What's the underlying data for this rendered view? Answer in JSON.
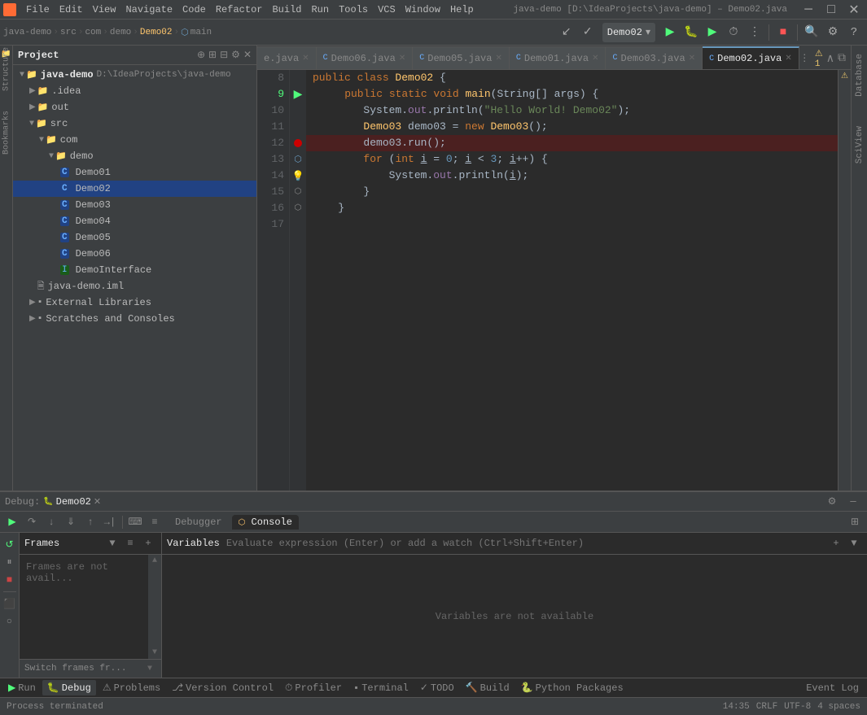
{
  "menubar": {
    "items": [
      "File",
      "Edit",
      "View",
      "Navigate",
      "Code",
      "Refactor",
      "Build",
      "Run",
      "Tools",
      "VCS",
      "Window",
      "Help"
    ]
  },
  "titlebar": {
    "project": "java-demo",
    "path": "D:\\IdeaProjects\\java-demo",
    "separator": "–",
    "file": "Demo02.java"
  },
  "breadcrumb": {
    "items": [
      "java-demo",
      "src",
      "com",
      "demo",
      "Demo02",
      "main"
    ]
  },
  "toolbar": {
    "run_config": "Demo02",
    "buttons": [
      "run",
      "debug",
      "run-coverage",
      "profile",
      "stop"
    ]
  },
  "tabs": [
    {
      "label": "e.java",
      "active": false,
      "modified": false
    },
    {
      "label": "Demo06.java",
      "active": false,
      "modified": false
    },
    {
      "label": "Demo05.java",
      "active": false,
      "modified": false
    },
    {
      "label": "Demo01.java",
      "active": false,
      "modified": false
    },
    {
      "label": "Demo03.java",
      "active": false,
      "modified": false
    },
    {
      "label": "Demo02.java",
      "active": true,
      "modified": false
    }
  ],
  "project": {
    "title": "Project",
    "root": {
      "name": "java-demo",
      "path": "D:\\IdeaProjects\\java-demo",
      "children": [
        {
          "name": ".idea",
          "type": "folder",
          "indent": 1
        },
        {
          "name": "out",
          "type": "folder",
          "indent": 1
        },
        {
          "name": "src",
          "type": "folder",
          "indent": 1,
          "expanded": true,
          "children": [
            {
              "name": "com",
              "type": "folder",
              "indent": 2,
              "expanded": true,
              "children": [
                {
                  "name": "demo",
                  "type": "folder",
                  "indent": 3,
                  "expanded": true,
                  "children": [
                    {
                      "name": "Demo01",
                      "type": "java",
                      "indent": 4
                    },
                    {
                      "name": "Demo02",
                      "type": "java",
                      "indent": 4,
                      "selected": true
                    },
                    {
                      "name": "Demo03",
                      "type": "java",
                      "indent": 4
                    },
                    {
                      "name": "Demo04",
                      "type": "java",
                      "indent": 4
                    },
                    {
                      "name": "Demo05",
                      "type": "java",
                      "indent": 4
                    },
                    {
                      "name": "Demo06",
                      "type": "java",
                      "indent": 4
                    },
                    {
                      "name": "DemoInterface",
                      "type": "interface",
                      "indent": 4
                    }
                  ]
                }
              ]
            }
          ]
        },
        {
          "name": "java-demo.iml",
          "type": "iml",
          "indent": 1
        },
        {
          "name": "External Libraries",
          "type": "libs",
          "indent": 1
        },
        {
          "name": "Scratches and Consoles",
          "type": "libs",
          "indent": 1
        }
      ]
    }
  },
  "editor": {
    "lines": [
      {
        "num": "8",
        "content": "",
        "breakpoint": false
      },
      {
        "num": "9",
        "content": "    public static void main(String[] args) {",
        "breakpoint": false,
        "run": true
      },
      {
        "num": "10",
        "content": "        System.out.println(\"Hello World! Demo02\");",
        "breakpoint": false
      },
      {
        "num": "11",
        "content": "        Demo03 demo03 = new Demo03();",
        "breakpoint": false
      },
      {
        "num": "12",
        "content": "        demo03.run();",
        "breakpoint": true
      },
      {
        "num": "13",
        "content": "        for (int i = 0; i < 3; i++) {",
        "breakpoint": false,
        "debug": true
      },
      {
        "num": "14",
        "content": "            System.out.println(i);",
        "breakpoint": false,
        "bulb": true
      },
      {
        "num": "15",
        "content": "        }",
        "breakpoint": false
      },
      {
        "num": "16",
        "content": "    }",
        "breakpoint": false
      },
      {
        "num": "17",
        "content": "",
        "breakpoint": false
      }
    ]
  },
  "debug": {
    "title": "Debug:",
    "config_name": "Demo02",
    "tabs": [
      "Debugger",
      "Console"
    ],
    "active_tab": "Console",
    "frames": {
      "title": "Frames",
      "empty_text": "Frames are not avail..."
    },
    "variables": {
      "title": "Variables",
      "placeholder": "Evaluate expression (Enter) or add a watch (Ctrl+Shift+Enter)",
      "empty_text": "Variables are not available"
    },
    "switch_frames": "Switch frames fr..."
  },
  "statusbar": {
    "items": [
      "Run",
      "Debug",
      "Problems",
      "Version Control",
      "Profiler",
      "Terminal",
      "TODO",
      "Build",
      "Python Packages"
    ],
    "right_items": [
      "Event Log"
    ],
    "process_text": "Process terminated",
    "position": "14:35",
    "encoding": "CRLF",
    "charset": "UTF-8",
    "indent": "4 spaces"
  },
  "right_panels": [
    "Database",
    "SciView"
  ],
  "warnings": "1"
}
